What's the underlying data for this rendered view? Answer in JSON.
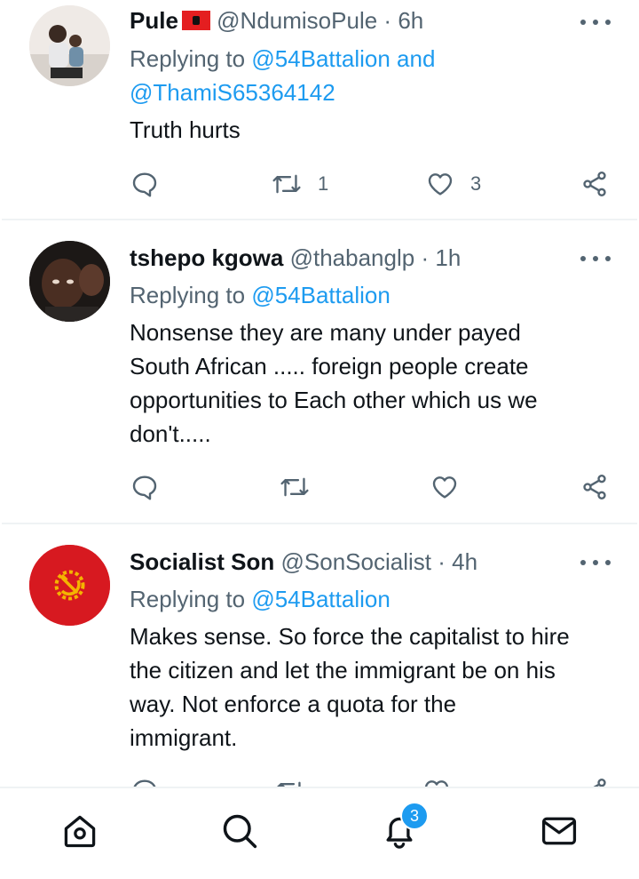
{
  "tweets": [
    {
      "name": "Pule",
      "handle": "@NdumisoPule",
      "time": "6h",
      "replying_prefix": "Replying to",
      "replying_mentions_line1": "@54Battalion and",
      "replying_mentions_line2": "@ThamiS65364142",
      "text_lines": [
        "Truth hurts"
      ],
      "replies": "",
      "retweets": "1",
      "likes": "3"
    },
    {
      "name": "tshepo kgowa",
      "handle": "@thabanglp",
      "time": "1h",
      "replying_prefix": "Replying to",
      "replying_mentions_line1": "@54Battalion",
      "text_lines": [
        "Nonsense they are many under payed",
        "South African ..... foreign people create",
        "opportunities to Each other which us we",
        "don't....."
      ],
      "replies": "",
      "retweets": "",
      "likes": ""
    },
    {
      "name": "Socialist Son",
      "handle": "@SonSocialist",
      "time": "4h",
      "replying_prefix": "Replying to",
      "replying_mentions_line1": "@54Battalion",
      "text_lines": [
        "Makes sense. So force the capitalist to hire",
        "the citizen and let the immigrant be on his",
        "way. Not enforce a quota for the",
        "immigrant."
      ]
    }
  ],
  "dot_separator": "·",
  "navbar": {
    "items": [
      {
        "icon": "home-icon"
      },
      {
        "icon": "search-icon"
      },
      {
        "icon": "notifications-icon",
        "badge": "3"
      },
      {
        "icon": "messages-icon"
      }
    ]
  },
  "colors": {
    "accent": "#1d9bf0",
    "secondary_text": "#536471",
    "primary_text": "#0f1419"
  }
}
